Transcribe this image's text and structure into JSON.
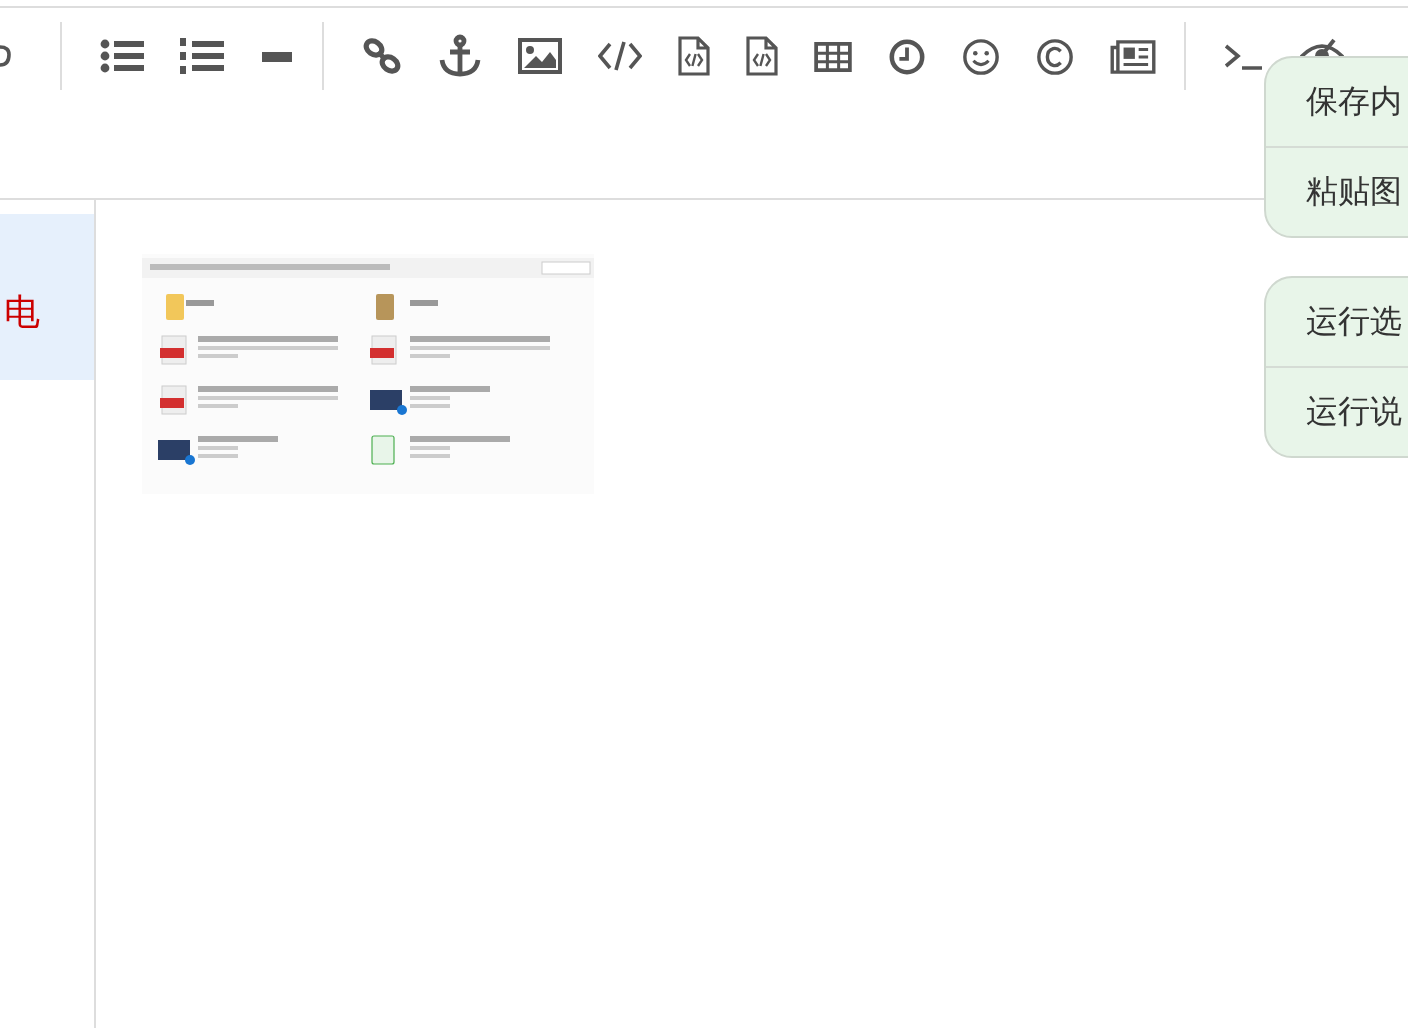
{
  "sidebar": {
    "items": [
      {
        "label": "电",
        "selected": true
      }
    ]
  },
  "context_menus": [
    {
      "items": [
        "保存内",
        "粘贴图"
      ]
    },
    {
      "items": [
        "运行选",
        "运行说"
      ]
    }
  ]
}
